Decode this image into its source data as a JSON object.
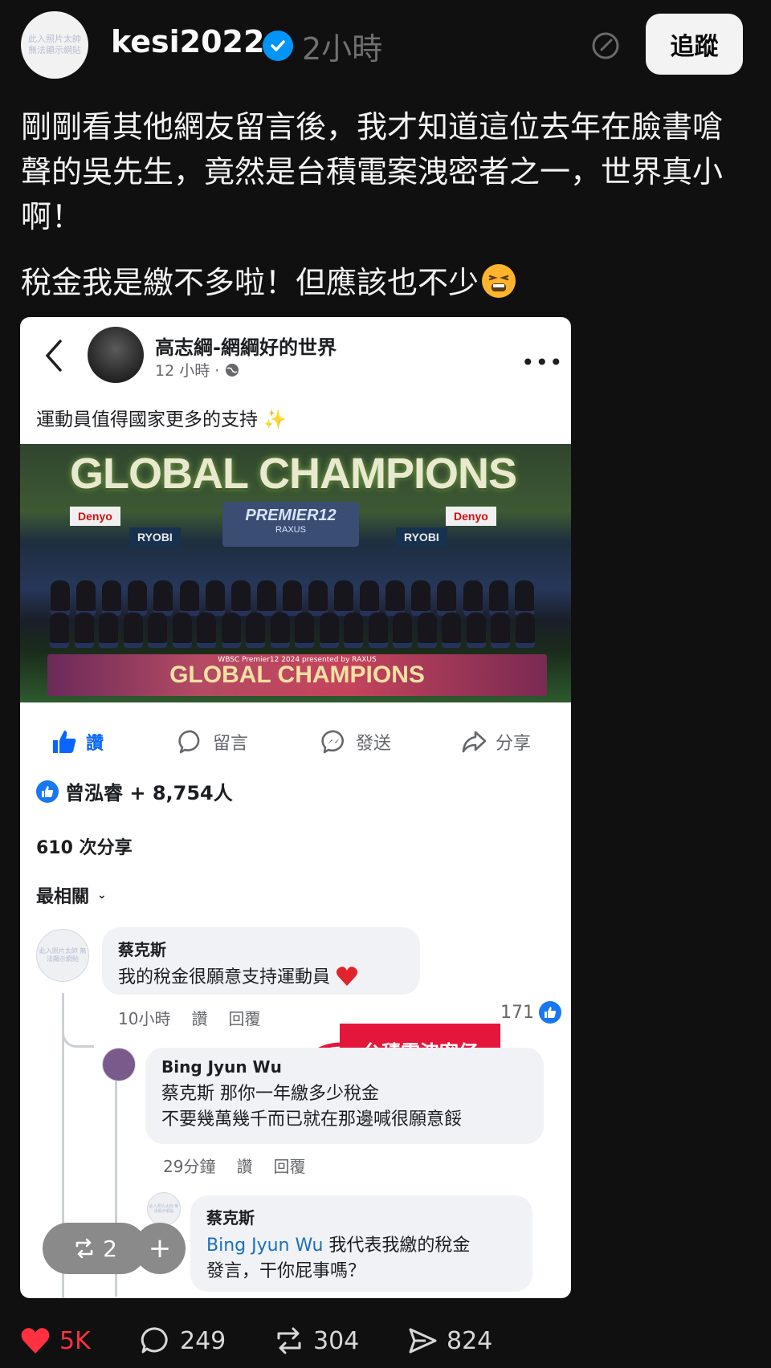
{
  "header": {
    "avatar_placeholder": "此入照片太帥 無法顯示網貼",
    "username": "kesi2022",
    "time": "2小時",
    "follow_label": "追蹤"
  },
  "post": {
    "text": "剛剛看其他網友留言後，我才知道這位去年在臉書嗆聲的吳先生，竟然是台積電案洩密者之一，世界真小啊！",
    "text2": "稅金我是繳不多啦！但應該也不少"
  },
  "fb": {
    "page_name": "高志綱-網綱好的世界",
    "time": "12 小時 ·",
    "caption": "運動員值得國家更多的支持 ✨",
    "photo": {
      "title": "GLOBAL CHAMPIONS",
      "screen_text": "PREMIER12",
      "screen_sub": "RAXUS",
      "banner_text": "GLOBAL CHAMPIONS",
      "banner_small": "WBSC Premier12 2024 presented by RAXUS",
      "sign_denyo": "Denyo",
      "sign_ryobi": "RYOBI"
    },
    "actions": {
      "like": "讚",
      "comment": "留言",
      "send": "發送",
      "share": "分享"
    },
    "reactions": "曾泓睿 + 8,754人",
    "shares": "610 次分享",
    "sort": "最相關",
    "comments": [
      {
        "name": "蔡克斯",
        "text": "我的稅金很願意支持運動員",
        "time": "10小時",
        "like": "讚",
        "reply": "回覆",
        "likes": "171"
      },
      {
        "name": "Bing Jyun Wu",
        "line1": "蔡克斯 那你一年繳多少稅金",
        "line2": "不要幾萬幾千而已就在那邊喊很願意餒",
        "time": "29分鐘",
        "like": "讚",
        "reply": "回覆"
      },
      {
        "name": "蔡克斯",
        "mention": "Bing Jyun Wu",
        "line1": " 我代表我繳的稅金",
        "line2": "發言，干你屁事嗎？"
      }
    ],
    "annotation": "台積電洩密仔",
    "repost_count": "2",
    "add_label": "+"
  },
  "footer": {
    "likes": "5K",
    "comments": "249",
    "reposts": "304",
    "shares": "824"
  },
  "colors": {
    "background": "#101010",
    "verified": "#0095f6",
    "fb_blue": "#0866ff",
    "tag_red": "#e5163b",
    "heart": "#ff3040"
  }
}
